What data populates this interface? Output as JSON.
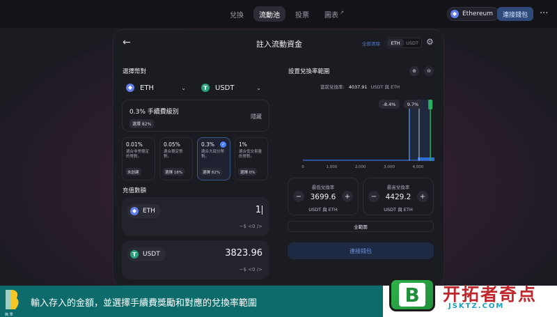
{
  "nav": {
    "tabs": [
      {
        "label": "兌換"
      },
      {
        "label": "流動池"
      },
      {
        "label": "投票"
      },
      {
        "label": "圖表",
        "arrow": "↗"
      }
    ],
    "network": "Ethereum",
    "connect": "連接錢包",
    "more": "···"
  },
  "card": {
    "back": "←",
    "title": "註入流動資金",
    "clear_all": "全部清除",
    "toggle": [
      "ETH",
      "USDT"
    ],
    "settings": "⚙"
  },
  "select_pair": {
    "label": "選擇幣對",
    "token_a": "ETH",
    "token_b": "USDT",
    "chevron": "⌄"
  },
  "fee": {
    "title": "0.3% 手續費級別",
    "selected_pill": "選擇 82%",
    "hide": "隱藏",
    "tiers": [
      {
        "pct": "0.01%",
        "desc": "適合非常穩定的幣對。",
        "pill": "未創建"
      },
      {
        "pct": "0.05%",
        "desc": "適合穩定幣對。",
        "pill": "選擇 18%"
      },
      {
        "pct": "0.3%",
        "desc": "適合大部分幣對。",
        "pill": "選擇 82%"
      },
      {
        "pct": "1%",
        "desc": "適合低交易量的幣對。",
        "pill": "選擇 0%"
      }
    ]
  },
  "deposit": {
    "label": "充值數額",
    "rows": [
      {
        "token": "ETH",
        "value": "1",
        "usd": "~$ <0 />"
      },
      {
        "token": "USDT",
        "value": "3823.96",
        "usd": "~$ <0 />"
      }
    ]
  },
  "range": {
    "label": "設置兌換率範圍",
    "zoom_in": "⊕",
    "zoom_out": "⊖",
    "current_label": "當前兌換率:",
    "current_value": "4037.91",
    "current_unit": "USDT 與 ETH",
    "min_pct": "-8.4%",
    "max_pct": "9.7%",
    "min": {
      "label": "最低兌換率",
      "value": "3699.6",
      "unit": "USDT 與 ETH"
    },
    "max": {
      "label": "最高兌換率",
      "value": "4429.2",
      "unit": "USDT 與 ETH"
    },
    "minus": "−",
    "plus": "+",
    "full_range": "全範圍",
    "connect": "連接錢包"
  },
  "chart_data": {
    "type": "area",
    "x_ticks": [
      "0",
      "1,000",
      "2,000",
      "3,000",
      "4,000"
    ],
    "xlim": [
      0,
      4450
    ],
    "current_price": 4037.91,
    "range_min": 3699.6,
    "range_max": 4429.2
  },
  "banner": {
    "logo_text": "簡 學",
    "caption": "輸入存入的金額，並選擇手續費獎勵和對應的兌換率範圍",
    "brand_name": "开拓者奇点",
    "brand_url": "JSKTZ.COM",
    "brand_letter": "B"
  },
  "colors": {
    "accent": "#4c82fb",
    "green_handle": "#27ae60",
    "banner": "#0e6b6b",
    "brand_red": "#c0262b"
  }
}
